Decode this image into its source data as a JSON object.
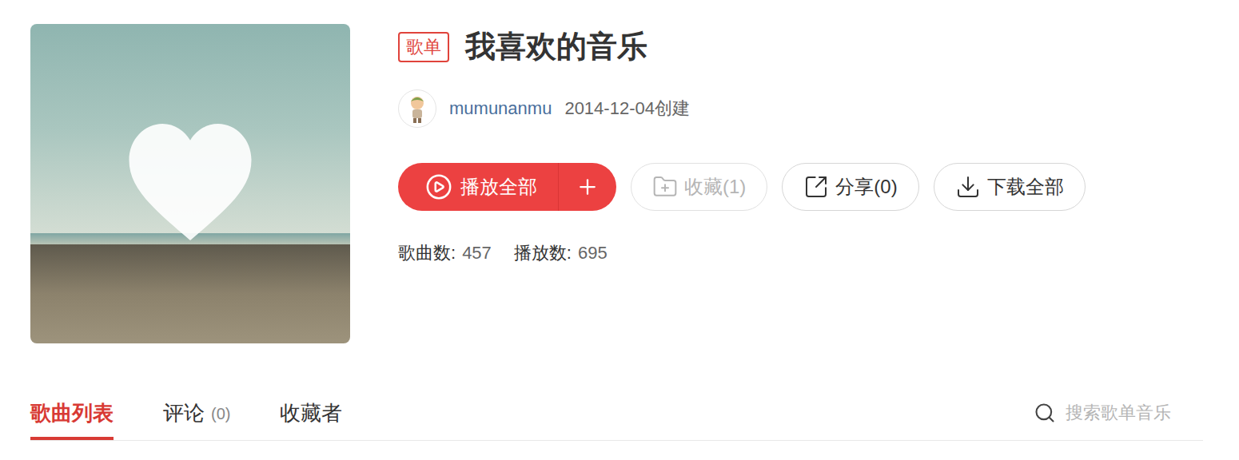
{
  "playlist": {
    "badge": "歌单",
    "title": "我喜欢的音乐",
    "creator": "mumunanmu",
    "created": "2014-12-04创建"
  },
  "actions": [
    {
      "label": "播放全部",
      "kind": "play",
      "disabled": false
    },
    {
      "label": "收藏(1)",
      "kind": "collect",
      "disabled": true
    },
    {
      "label": "分享(0)",
      "kind": "share",
      "disabled": false
    },
    {
      "label": "下载全部",
      "kind": "download",
      "disabled": false
    }
  ],
  "stats": [
    {
      "label": "歌曲数:",
      "value": "457"
    },
    {
      "label": "播放数:",
      "value": "695"
    }
  ],
  "tabs": [
    {
      "label": "歌曲列表",
      "selected": true
    },
    {
      "label": "评论",
      "count": "(0)",
      "selected": false
    },
    {
      "label": "收藏者",
      "selected": false
    }
  ],
  "search": {
    "placeholder": "搜索歌单音乐"
  }
}
